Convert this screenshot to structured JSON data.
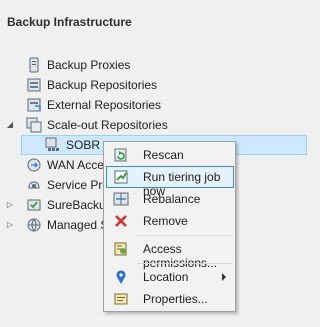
{
  "panel": {
    "title": "Backup Infrastructure"
  },
  "tree": {
    "items": [
      {
        "label": "Backup Proxies"
      },
      {
        "label": "Backup Repositories"
      },
      {
        "label": "External Repositories"
      },
      {
        "label": "Scale-out Repositories"
      },
      {
        "label": "SOBR"
      },
      {
        "label": "WAN Accel"
      },
      {
        "label": "Service Prov"
      },
      {
        "label": "SureBackup"
      },
      {
        "label": "Managed S"
      }
    ]
  },
  "context_menu": {
    "items": [
      {
        "label": "Rescan"
      },
      {
        "label": "Run tiering job now"
      },
      {
        "label": "Rebalance"
      },
      {
        "label": "Remove"
      },
      {
        "label": "Access permissions..."
      },
      {
        "label": "Location"
      },
      {
        "label": "Properties..."
      }
    ]
  },
  "colors": {
    "selection_bg": "#cde8ff",
    "menu_highlight_border": "#3c8bd1",
    "remove_icon": "#d32f2f"
  }
}
